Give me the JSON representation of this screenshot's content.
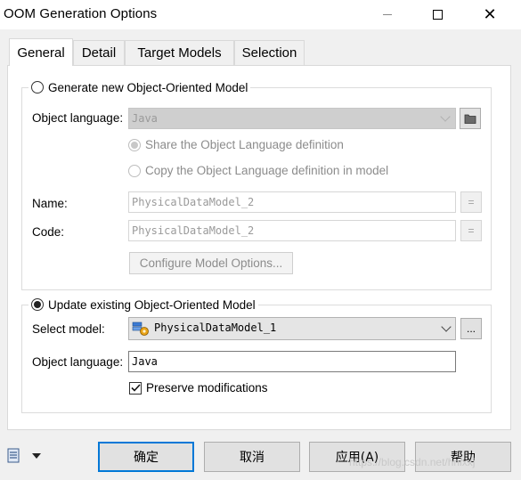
{
  "window": {
    "title": "OOM Generation Options",
    "minimize_icon": "minimize-icon",
    "maximize_icon": "maximize-icon",
    "close_icon": "close-icon"
  },
  "tabs": [
    {
      "label": "General",
      "active": true
    },
    {
      "label": "Detail",
      "active": false
    },
    {
      "label": "Target Models",
      "active": false
    },
    {
      "label": "Selection",
      "active": false
    }
  ],
  "generate_new": {
    "radio_label": "Generate new Object-Oriented Model",
    "selected": false,
    "object_language_label": "Object language:",
    "object_language_value": "Java",
    "share_label": "Share the Object Language definition",
    "copy_label": "Copy the Object Language definition in model",
    "name_label": "Name:",
    "name_value": "PhysicalDataModel_2",
    "code_label": "Code:",
    "code_value": "PhysicalDataModel_2",
    "equals_symbol": "=",
    "configure_button": "Configure Model Options..."
  },
  "update_existing": {
    "radio_label": "Update existing Object-Oriented Model",
    "selected": true,
    "select_model_label": "Select model:",
    "select_model_value": "PhysicalDataModel_1",
    "browse_button": "...",
    "object_language_label": "Object language:",
    "object_language_value": "Java",
    "preserve_label": "Preserve modifications",
    "preserve_checked": true
  },
  "footer": {
    "ok": "确定",
    "cancel": "取消",
    "apply": "应用(A)",
    "help": "帮助",
    "watermark": "https://blog.csdn.net/hnlxxj"
  },
  "colors": {
    "accent_border": "#0078d7",
    "panel_bg": "#ffffff",
    "dialog_bg": "#f0f0f0"
  }
}
